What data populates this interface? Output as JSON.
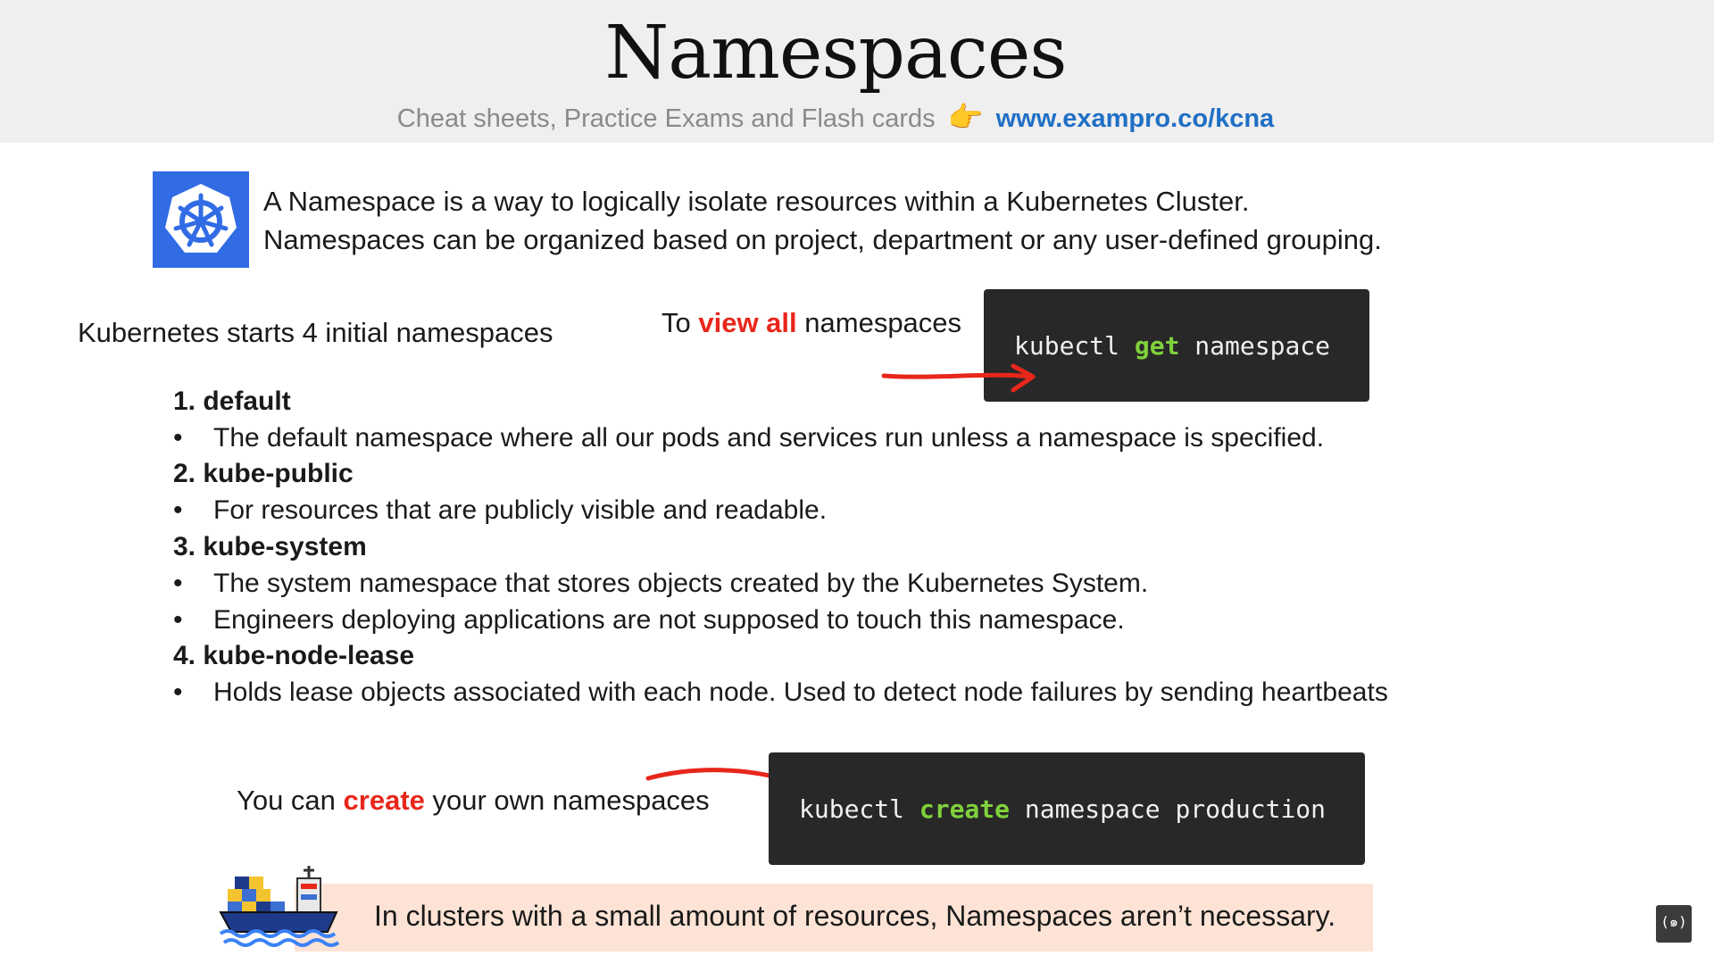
{
  "header": {
    "title": "Namespaces",
    "subtitle": "Cheat sheets, Practice Exams and Flash cards",
    "hand_emoji": "👉",
    "link": "www.exampro.co/kcna"
  },
  "intro": {
    "line1": "A Namespace is a way to logically isolate resources within a Kubernetes Cluster.",
    "line2": "Namespaces can be organized based on project, department or any user-defined grouping."
  },
  "initial": {
    "label": "Kubernetes starts 4 initial namespaces",
    "namespaces": [
      {
        "name": "1. default",
        "bullets": [
          "The  default namespace where all our pods and services run unless a namespace is specified."
        ]
      },
      {
        "name": "2. kube-public",
        "bullets": [
          "For resources that are publicly visible and readable."
        ]
      },
      {
        "name": "3. kube-system",
        "bullets": [
          "The system namespace that stores objects created by the Kubernetes System.",
          "Engineers deploying applications are not supposed to touch this namespace."
        ]
      },
      {
        "name": "4. kube-node-lease",
        "bullets": [
          "Holds lease objects associated with each node. Used to detect node failures by sending heartbeats"
        ]
      }
    ]
  },
  "view_all": {
    "prefix": "To ",
    "highlight": "view all",
    "suffix": " namespaces",
    "cmd_pre": "kubectl ",
    "cmd_verb": "get",
    "cmd_post": " namespace"
  },
  "create": {
    "prefix": "You can ",
    "highlight": "create",
    "suffix": " your own namespaces",
    "cmd_pre": "kubectl ",
    "cmd_verb": "create",
    "cmd_post": " namespace production"
  },
  "note": {
    "text": "In clusters with a small amount of resources, Namespaces aren’t necessary."
  },
  "bullet_char": "•",
  "icons": {
    "logo": "kubernetes-logo",
    "ship": "container-ship-icon",
    "watermark": "freecodecamp-icon"
  },
  "colors": {
    "accent_red": "#e8261b",
    "cmd_green": "#7fd13b",
    "link_blue": "#1f6fc5",
    "code_bg": "#282828",
    "note_bg": "#fde3d5",
    "k8s_blue": "#326ce5"
  }
}
